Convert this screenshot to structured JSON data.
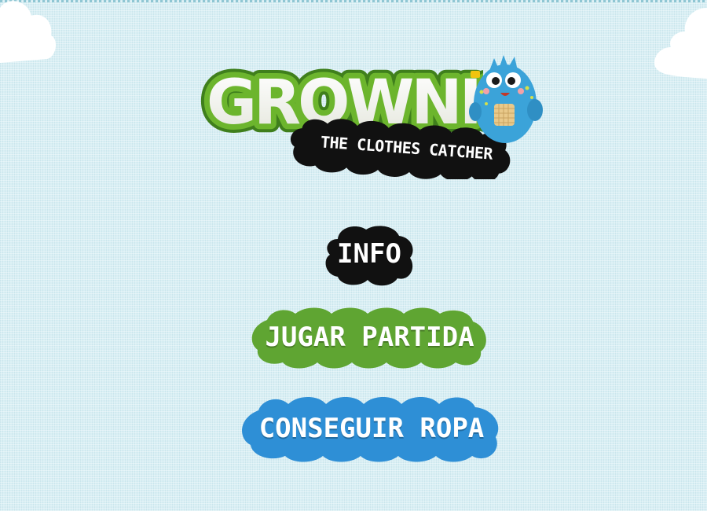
{
  "game": {
    "logo_title": "GROWNIES",
    "tagline": "THE CLOTHES CATCHER",
    "mascot_name": "mascot-monster"
  },
  "menu": {
    "info_label": "INFO",
    "play_label": "JUGAR PARTIDA",
    "shop_label": "CONSEGUIR ROPA"
  },
  "colors": {
    "background": "#d9eff4",
    "logo_green": "#6cb52d",
    "info_button": "#111111",
    "play_button": "#5fa532",
    "shop_button": "#2e8fd6",
    "mascot_blue": "#3ba3d9"
  }
}
